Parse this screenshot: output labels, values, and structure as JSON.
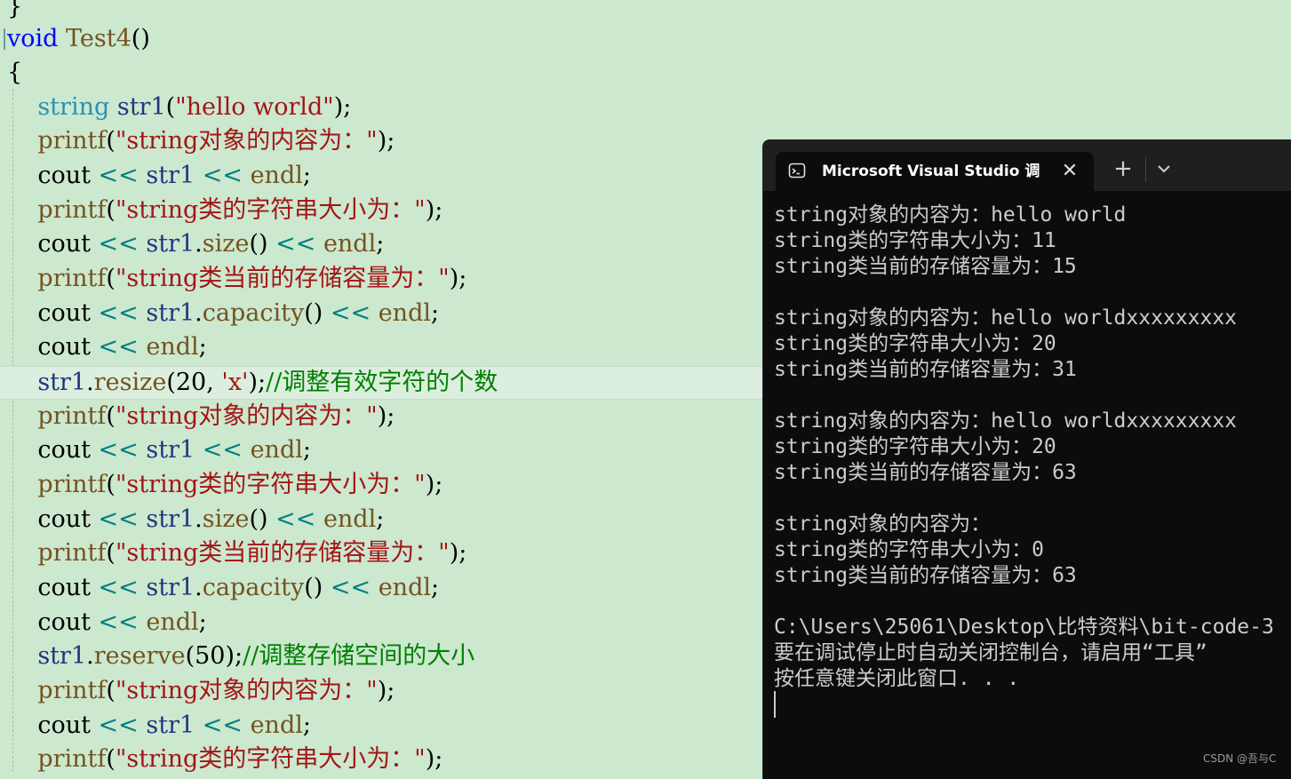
{
  "editor": {
    "lines": [
      [
        {
          "t": "}",
          "c": "pl"
        }
      ],
      [
        {
          "t": "void",
          "c": "kw"
        },
        {
          "t": " Test4",
          "c": "fn"
        },
        {
          "t": "()",
          "c": "pl"
        }
      ],
      [
        {
          "t": "{",
          "c": "pl"
        }
      ],
      [
        {
          "t": "    string",
          "c": "type"
        },
        {
          "t": " str1",
          "c": "id"
        },
        {
          "t": "(",
          "c": "pl"
        },
        {
          "t": "\"hello world\"",
          "c": "str"
        },
        {
          "t": ");",
          "c": "pl"
        }
      ],
      [
        {
          "t": "    printf",
          "c": "fn"
        },
        {
          "t": "(",
          "c": "pl"
        },
        {
          "t": "\"string对象的内容为：\"",
          "c": "str"
        },
        {
          "t": ");",
          "c": "pl"
        }
      ],
      [
        {
          "t": "    cout ",
          "c": "pl"
        },
        {
          "t": "<<",
          "c": "op"
        },
        {
          "t": " str1 ",
          "c": "id"
        },
        {
          "t": "<<",
          "c": "op"
        },
        {
          "t": " endl",
          "c": "fn"
        },
        {
          "t": ";",
          "c": "pl"
        }
      ],
      [
        {
          "t": "    printf",
          "c": "fn"
        },
        {
          "t": "(",
          "c": "pl"
        },
        {
          "t": "\"string类的字符串大小为：\"",
          "c": "str"
        },
        {
          "t": ");",
          "c": "pl"
        }
      ],
      [
        {
          "t": "    cout ",
          "c": "pl"
        },
        {
          "t": "<<",
          "c": "op"
        },
        {
          "t": " str1",
          "c": "id"
        },
        {
          "t": ".",
          "c": "pl"
        },
        {
          "t": "size",
          "c": "fn"
        },
        {
          "t": "() ",
          "c": "pl"
        },
        {
          "t": "<<",
          "c": "op"
        },
        {
          "t": " endl",
          "c": "fn"
        },
        {
          "t": ";",
          "c": "pl"
        }
      ],
      [
        {
          "t": "    printf",
          "c": "fn"
        },
        {
          "t": "(",
          "c": "pl"
        },
        {
          "t": "\"string类当前的存储容量为：\"",
          "c": "str"
        },
        {
          "t": ");",
          "c": "pl"
        }
      ],
      [
        {
          "t": "    cout ",
          "c": "pl"
        },
        {
          "t": "<<",
          "c": "op"
        },
        {
          "t": " str1",
          "c": "id"
        },
        {
          "t": ".",
          "c": "pl"
        },
        {
          "t": "capacity",
          "c": "fn"
        },
        {
          "t": "() ",
          "c": "pl"
        },
        {
          "t": "<<",
          "c": "op"
        },
        {
          "t": " endl",
          "c": "fn"
        },
        {
          "t": ";",
          "c": "pl"
        }
      ],
      [
        {
          "t": "    cout ",
          "c": "pl"
        },
        {
          "t": "<<",
          "c": "op"
        },
        {
          "t": " endl",
          "c": "fn"
        },
        {
          "t": ";",
          "c": "pl"
        }
      ],
      [
        {
          "t": "    str1",
          "c": "id"
        },
        {
          "t": ".",
          "c": "pl"
        },
        {
          "t": "resize",
          "c": "fn"
        },
        {
          "t": "(20, ",
          "c": "pl"
        },
        {
          "t": "'x'",
          "c": "str"
        },
        {
          "t": ");",
          "c": "pl"
        },
        {
          "t": "//调整有效字符的个数",
          "c": "cm"
        }
      ],
      [
        {
          "t": "    printf",
          "c": "fn"
        },
        {
          "t": "(",
          "c": "pl"
        },
        {
          "t": "\"string对象的内容为：\"",
          "c": "str"
        },
        {
          "t": ");",
          "c": "pl"
        }
      ],
      [
        {
          "t": "    cout ",
          "c": "pl"
        },
        {
          "t": "<<",
          "c": "op"
        },
        {
          "t": " str1 ",
          "c": "id"
        },
        {
          "t": "<<",
          "c": "op"
        },
        {
          "t": " endl",
          "c": "fn"
        },
        {
          "t": ";",
          "c": "pl"
        }
      ],
      [
        {
          "t": "    printf",
          "c": "fn"
        },
        {
          "t": "(",
          "c": "pl"
        },
        {
          "t": "\"string类的字符串大小为：\"",
          "c": "str"
        },
        {
          "t": ");",
          "c": "pl"
        }
      ],
      [
        {
          "t": "    cout ",
          "c": "pl"
        },
        {
          "t": "<<",
          "c": "op"
        },
        {
          "t": " str1",
          "c": "id"
        },
        {
          "t": ".",
          "c": "pl"
        },
        {
          "t": "size",
          "c": "fn"
        },
        {
          "t": "() ",
          "c": "pl"
        },
        {
          "t": "<<",
          "c": "op"
        },
        {
          "t": " endl",
          "c": "fn"
        },
        {
          "t": ";",
          "c": "pl"
        }
      ],
      [
        {
          "t": "    printf",
          "c": "fn"
        },
        {
          "t": "(",
          "c": "pl"
        },
        {
          "t": "\"string类当前的存储容量为：\"",
          "c": "str"
        },
        {
          "t": ");",
          "c": "pl"
        }
      ],
      [
        {
          "t": "    cout ",
          "c": "pl"
        },
        {
          "t": "<<",
          "c": "op"
        },
        {
          "t": " str1",
          "c": "id"
        },
        {
          "t": ".",
          "c": "pl"
        },
        {
          "t": "capacity",
          "c": "fn"
        },
        {
          "t": "() ",
          "c": "pl"
        },
        {
          "t": "<<",
          "c": "op"
        },
        {
          "t": " endl",
          "c": "fn"
        },
        {
          "t": ";",
          "c": "pl"
        }
      ],
      [
        {
          "t": "    cout ",
          "c": "pl"
        },
        {
          "t": "<<",
          "c": "op"
        },
        {
          "t": " endl",
          "c": "fn"
        },
        {
          "t": ";",
          "c": "pl"
        }
      ],
      [
        {
          "t": "    str1",
          "c": "id"
        },
        {
          "t": ".",
          "c": "pl"
        },
        {
          "t": "reserve",
          "c": "fn"
        },
        {
          "t": "(50);",
          "c": "pl"
        },
        {
          "t": "//调整存储空间的大小",
          "c": "cm"
        }
      ],
      [
        {
          "t": "    printf",
          "c": "fn"
        },
        {
          "t": "(",
          "c": "pl"
        },
        {
          "t": "\"string对象的内容为：\"",
          "c": "str"
        },
        {
          "t": ");",
          "c": "pl"
        }
      ],
      [
        {
          "t": "    cout ",
          "c": "pl"
        },
        {
          "t": "<<",
          "c": "op"
        },
        {
          "t": " str1 ",
          "c": "id"
        },
        {
          "t": "<<",
          "c": "op"
        },
        {
          "t": " endl",
          "c": "fn"
        },
        {
          "t": ";",
          "c": "pl"
        }
      ],
      [
        {
          "t": "    printf",
          "c": "fn"
        },
        {
          "t": "(",
          "c": "pl"
        },
        {
          "t": "\"string类的字符串大小为：\"",
          "c": "str"
        },
        {
          "t": ");",
          "c": "pl"
        }
      ]
    ],
    "current_line": 11,
    "colors": {
      "background": "#cce8cf",
      "keyword": "#0000ff",
      "type": "#2b91af",
      "string": "#a31515",
      "comment": "#008000"
    }
  },
  "terminal": {
    "tab_title": "Microsoft Visual Studio 调试控",
    "tab_icon": "terminal-icon",
    "close_label": "✕",
    "new_tab_label": "+",
    "dropdown_icon": "chevron-down-icon",
    "output": [
      "string对象的内容为：hello world",
      "string类的字符串大小为：11",
      "string类当前的存储容量为：15",
      "",
      "string对象的内容为：hello worldxxxxxxxxx",
      "string类的字符串大小为：20",
      "string类当前的存储容量为：31",
      "",
      "string对象的内容为：hello worldxxxxxxxxx",
      "string类的字符串大小为：20",
      "string类当前的存储容量为：63",
      "",
      "string对象的内容为：",
      "string类的字符串大小为：0",
      "string类当前的存储容量为：63",
      "",
      "C:\\Users\\25061\\Desktop\\比特资料\\bit-code-3",
      "要在调试停止时自动关闭控制台，请启用“工具”",
      "按任意键关闭此窗口. . ."
    ]
  },
  "watermark": "CSDN @吾与C"
}
